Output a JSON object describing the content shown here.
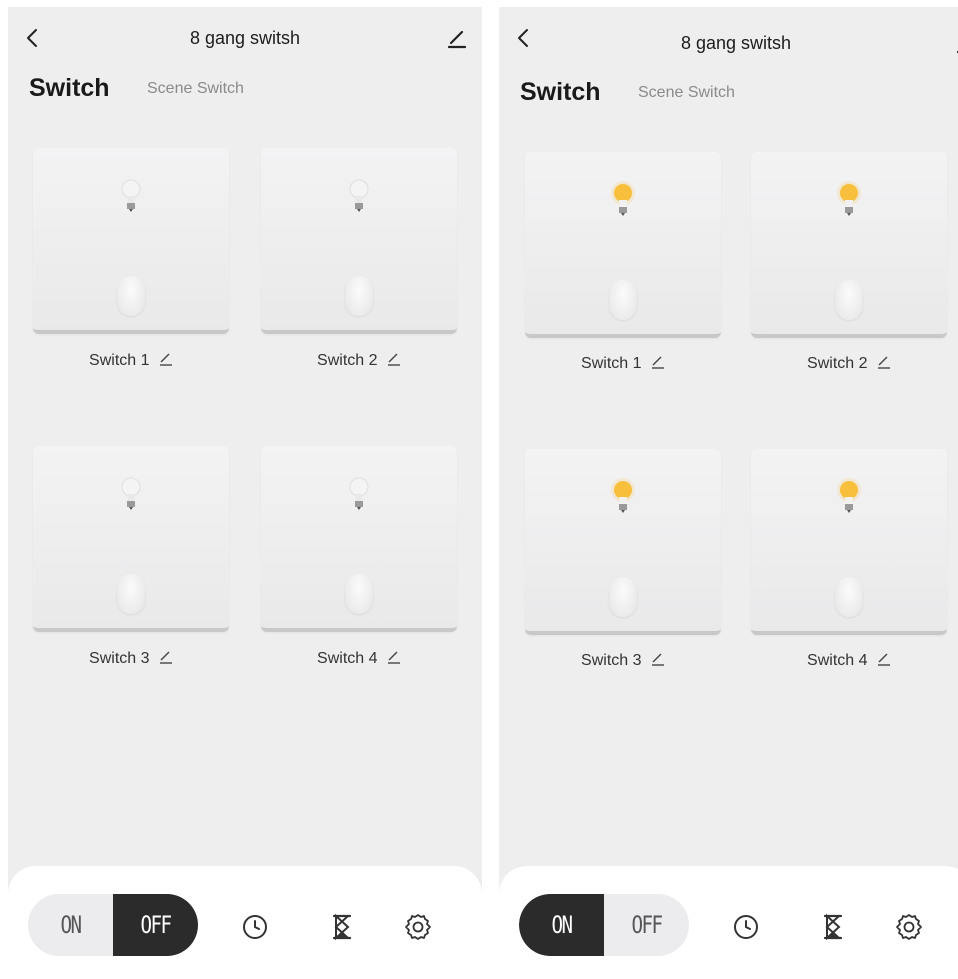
{
  "panels": [
    {
      "id": "left",
      "header": {
        "title": "8 gang switsh"
      },
      "tabs": {
        "active": "Switch",
        "other": "Scene Switch"
      },
      "switches": [
        {
          "label": "Switch 1",
          "state": "off"
        },
        {
          "label": "Switch 2",
          "state": "off"
        },
        {
          "label": "Switch 3",
          "state": "off"
        },
        {
          "label": "Switch 4",
          "state": "off"
        }
      ],
      "bottom": {
        "on_label": "ON",
        "off_label": "OFF",
        "selected": "OFF"
      }
    },
    {
      "id": "right",
      "header": {
        "title": "8 gang switsh"
      },
      "tabs": {
        "active": "Switch",
        "other": "Scene Switch"
      },
      "switches": [
        {
          "label": "Switch 1",
          "state": "on"
        },
        {
          "label": "Switch 2",
          "state": "on"
        },
        {
          "label": "Switch 3",
          "state": "on"
        },
        {
          "label": "Switch 4",
          "state": "on"
        }
      ],
      "bottom": {
        "on_label": "ON",
        "off_label": "OFF",
        "selected": "ON"
      }
    }
  ],
  "icons": {
    "back": "chevron-left-icon",
    "edit": "pencil-icon",
    "bulb": "light-bulb-icon",
    "clock": "clock-icon",
    "timer": "hourglass-icon",
    "settings": "gear-icon"
  },
  "colors": {
    "bulb_on": "#f7bf3c",
    "bulb_off": "#f4f4f4",
    "toggle_active": "#2b2b2b",
    "background": "#eeeeef"
  }
}
